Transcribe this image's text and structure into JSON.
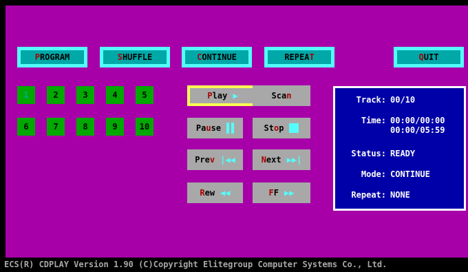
{
  "menu": {
    "program": {
      "hot": "P",
      "rest": "ROGRAM"
    },
    "shuffle": {
      "hot": "S",
      "rest": "HUFFLE"
    },
    "continue": {
      "hot": "C",
      "rest": "ONTINUE"
    },
    "repeat": {
      "pre": "REPEA",
      "hot": "T"
    },
    "quit": {
      "hot": "Q",
      "rest": "UIT"
    }
  },
  "tracks": [
    "1",
    "2",
    "3",
    "4",
    "5",
    "6",
    "7",
    "8",
    "9",
    "10"
  ],
  "controls": {
    "play": {
      "hot": "P",
      "rest": "lay",
      "glyph": "▶"
    },
    "scan": {
      "pre": "Sca",
      "hot": "n"
    },
    "pause": {
      "pre": "Pa",
      "hot": "u",
      "rest": "se"
    },
    "stop": {
      "pre": "St",
      "hot": "o",
      "rest": "p"
    },
    "prev": {
      "pre": "Pre",
      "hot": "v",
      "glyph": "|◀◀"
    },
    "next": {
      "hot": "N",
      "rest": "ext",
      "glyph": "▶▶|"
    },
    "rew": {
      "hot": "R",
      "rest": "ew",
      "glyph": "◀◀"
    },
    "ff": {
      "hot": "F",
      "rest": "F",
      "glyph": "▶▶"
    }
  },
  "info": {
    "track_label": "Track:",
    "track_value": "00/10",
    "time_label": "Time:",
    "time_value_1": "00:00/00:00",
    "time_value_2": "00:00/05:59",
    "status_label": "Status:",
    "status_value": "READY",
    "mode_label": "Mode:",
    "mode_value": "CONTINUE",
    "repeat_label": "Repeat:",
    "repeat_value": "NONE"
  },
  "statusbar": "ECS(R) CDPLAY Version 1.90  (C)Copyright Elitegroup Computer Systems Co., Ltd.",
  "colors": {
    "background": "#a800a8",
    "button_frame": "#54fcfc",
    "button_fill": "#00a8a8",
    "track": "#00a800",
    "info_panel": "#0000a8",
    "hotkey": "#a80000",
    "selection": "#fcfc54"
  }
}
